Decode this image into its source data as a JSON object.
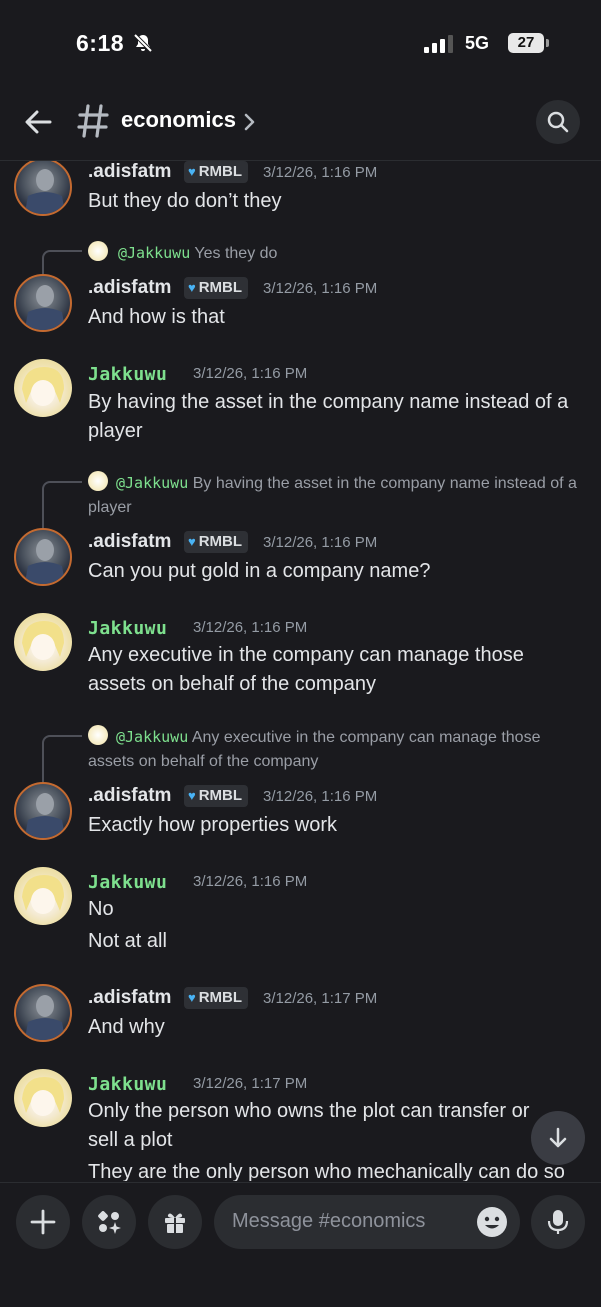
{
  "status_bar": {
    "time": "6:18",
    "network": "5G",
    "battery": "27"
  },
  "header": {
    "channel_name": "economics"
  },
  "messages": [
    {
      "author": ".adisfatm",
      "badge": "RMBL",
      "timestamp": "3/12/26, 1:16 PM",
      "lines": [
        "But they do don’t they"
      ]
    },
    {
      "reply_to": "@Jakkuwu",
      "reply_text": "Yes they do"
    },
    {
      "author": ".adisfatm",
      "badge": "RMBL",
      "timestamp": "3/12/26, 1:16 PM",
      "lines": [
        "And how is that"
      ]
    },
    {
      "author": "Jakkuwu",
      "timestamp": "3/12/26, 1:16 PM",
      "lines": [
        "By having the asset in the company name instead of a player"
      ]
    },
    {
      "reply_to": "@Jakkuwu",
      "reply_text": "By having the asset in the company name instead of a player"
    },
    {
      "author": ".adisfatm",
      "badge": "RMBL",
      "timestamp": "3/12/26, 1:16 PM",
      "lines": [
        "Can you put gold in a company name?"
      ]
    },
    {
      "author": "Jakkuwu",
      "timestamp": "3/12/26, 1:16 PM",
      "lines": [
        "Any executive in the company can manage those assets on behalf of the company"
      ]
    },
    {
      "reply_to": "@Jakkuwu",
      "reply_text": "Any executive in the company can manage those assets on behalf of the company"
    },
    {
      "author": ".adisfatm",
      "badge": "RMBL",
      "timestamp": "3/12/26, 1:16 PM",
      "lines": [
        "Exactly how properties work"
      ]
    },
    {
      "author": "Jakkuwu",
      "timestamp": "3/12/26, 1:16 PM",
      "lines": [
        "No",
        "Not at all"
      ]
    },
    {
      "author": ".adisfatm",
      "badge": "RMBL",
      "timestamp": "3/12/26, 1:17 PM",
      "lines": [
        "And why"
      ]
    },
    {
      "author": "Jakkuwu",
      "timestamp": "3/12/26, 1:17 PM",
      "lines": [
        "Only the person who owns the plot can transfer or sell a plot",
        "They are the only person who mechanically can do so"
      ]
    }
  ],
  "composer": {
    "placeholder": "Message #economics"
  },
  "icons": {
    "back": "arrow-left-icon",
    "hash": "hash-icon",
    "search": "search-icon",
    "jump": "arrow-down-icon",
    "plus": "plus-icon",
    "apps": "apps-sparkle-icon",
    "gift": "gift-icon",
    "emoji": "emoji-icon",
    "mic": "microphone-icon"
  },
  "colors": {
    "background": "#1a1a1e",
    "username_jakkuwu": "#7ee08e",
    "badge_heart": "#49b3f5"
  }
}
